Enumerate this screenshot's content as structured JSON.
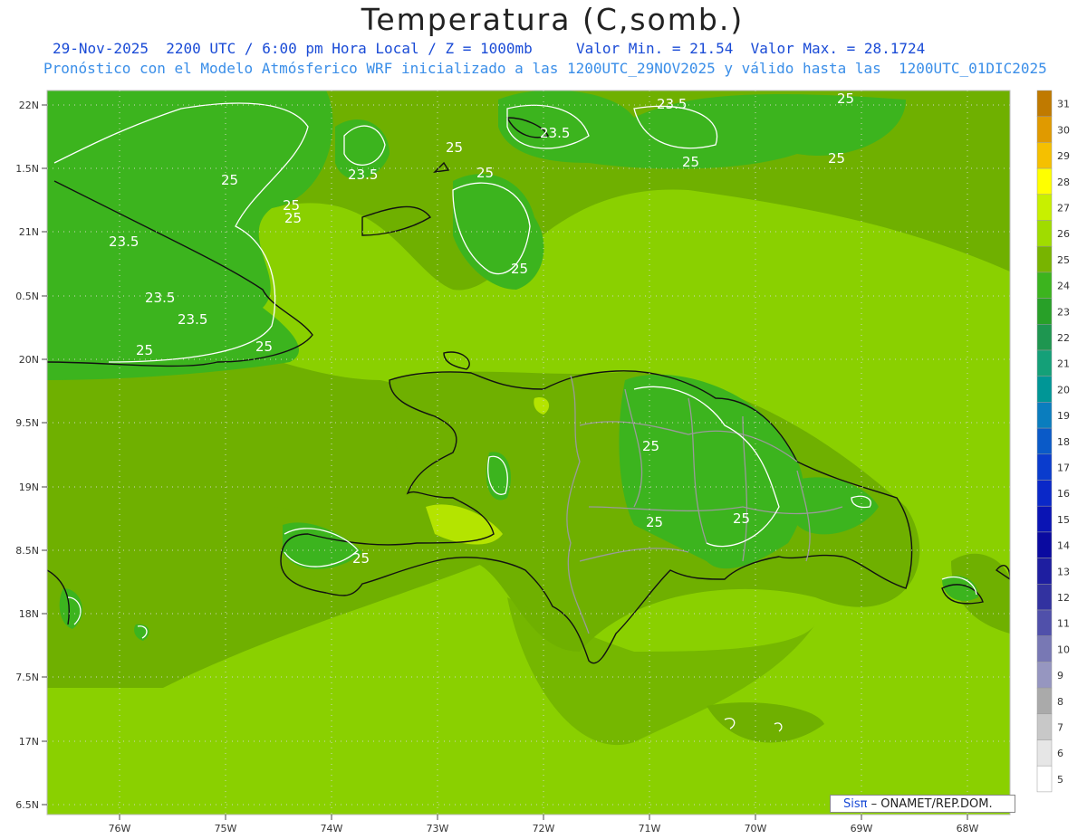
{
  "title": "Temperatura (C,somb.)",
  "subtitle_line1": "29-Nov-2025  2200 UTC / 6:00 pm Hora Local / Z = 1000mb     Valor Min. = 21.54  Valor Max. = 28.1724",
  "subtitle_line2": "Pronóstico con el Modelo Atmósferico WRF inicializado a las 1200UTC_29NOV2025 y válido hasta las  1200UTC_01DIC2025",
  "lat_labels": [
    "22N",
    "1.5N",
    "21N",
    "0.5N",
    "20N",
    "9.5N",
    "19N",
    "8.5N",
    "18N",
    "7.5N",
    "17N",
    "6.5N"
  ],
  "lon_labels": [
    "76W",
    "75W",
    "74W",
    "73W",
    "72W",
    "71W",
    "70W",
    "69W",
    "68W"
  ],
  "colorbar": {
    "labels": [
      "31",
      "30",
      "29",
      "28",
      "27",
      "26",
      "25",
      "24",
      "23",
      "22",
      "21",
      "20",
      "19",
      "18",
      "17",
      "16",
      "15",
      "14",
      "13",
      "12",
      "11",
      "10",
      "9",
      "8",
      "7",
      "6",
      "5"
    ],
    "colors": [
      "#c07a00",
      "#e09a00",
      "#f5c000",
      "#ffff00",
      "#c8f000",
      "#a0dc00",
      "#78b400",
      "#3cb41e",
      "#28a028",
      "#1e9650",
      "#14a078",
      "#009696",
      "#0a7dbe",
      "#0a5ac8",
      "#0a3ccd",
      "#0a28c8",
      "#0a14b4",
      "#0a0aa0",
      "#1e1ea0",
      "#3232a0",
      "#5050aa",
      "#7878b4",
      "#9696c0",
      "#aaaaaa",
      "#c8c8c8",
      "#e6e6e6",
      "#ffffff"
    ]
  },
  "contour_labels": [
    "23.5",
    "23.5",
    "25",
    "25",
    "25",
    "25",
    "23.5",
    "25",
    "25",
    "25",
    "23.5",
    "23.5",
    "23.5",
    "25",
    "25",
    "25",
    "25",
    "25",
    "25",
    "25",
    "25"
  ],
  "credit": {
    "logo": "Sisπ",
    "text": "– ONAMET/REP.DOM."
  }
}
